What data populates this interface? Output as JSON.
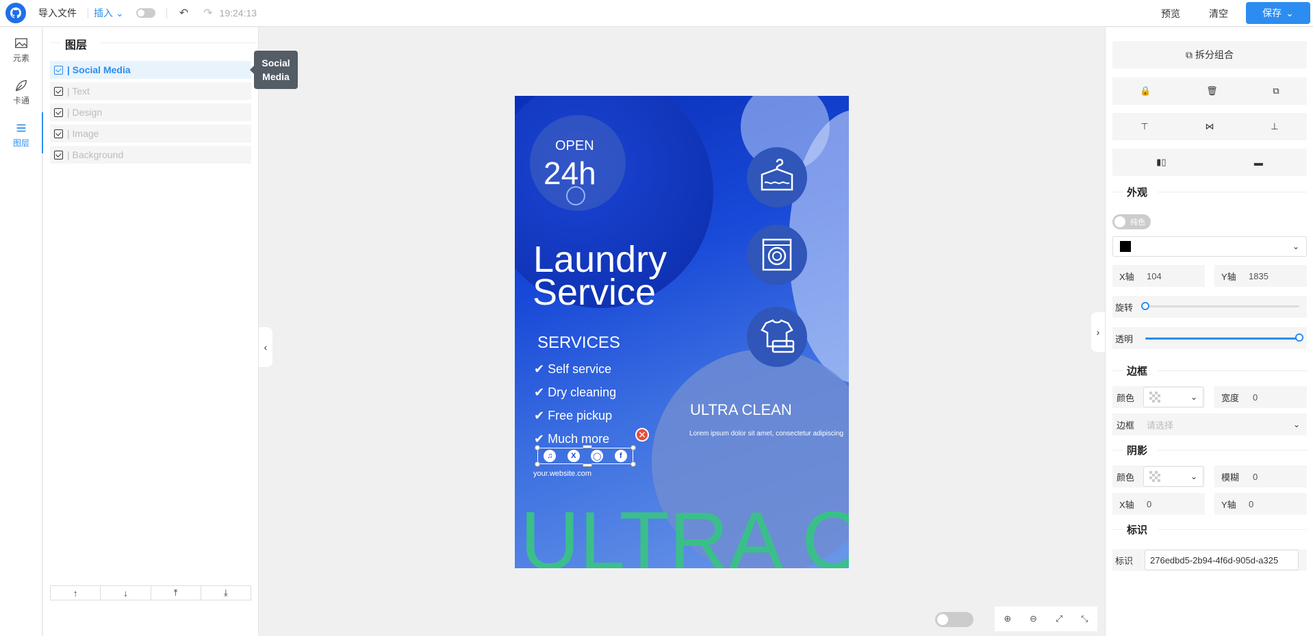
{
  "topbar": {
    "import_label": "导入文件",
    "insert_label": "插入",
    "time": "19:24:13",
    "preview_label": "预览",
    "clear_label": "清空",
    "save_label": "保存"
  },
  "leftnav": {
    "items": [
      {
        "label": "元素"
      },
      {
        "label": "卡通"
      },
      {
        "label": "图层"
      }
    ]
  },
  "layers": {
    "title": "图层",
    "items": [
      {
        "label": "| Social Media"
      },
      {
        "label": "| Text"
      },
      {
        "label": "| Design"
      },
      {
        "label": "| Image"
      },
      {
        "label": "| Background"
      }
    ],
    "tooltip": "Social Media"
  },
  "poster": {
    "open": "OPEN",
    "hours": "24h",
    "title1": "Laundry",
    "title2": "Service",
    "services_title": "SERVICES",
    "services": [
      "✔ Self service",
      "✔ Dry cleaning",
      "✔ Free pickup",
      "✔ Much more"
    ],
    "website": "your.website.com",
    "ultra_clean": "ULTRA CLEAN",
    "lorem": "Lorem ipsum dolor sit amet, consectetur adipiscing",
    "big_text": "ULTRA C"
  },
  "rightpanel": {
    "ungroup_label": "拆分组合",
    "appearance_title": "外观",
    "solid_label": "纯色",
    "fill_color": "#000000",
    "x_label": "X轴",
    "x_value": "104",
    "y_label": "Y轴",
    "y_value": "1835",
    "rotate_label": "旋转",
    "rotate_value": 0,
    "opacity_label": "透明",
    "opacity_value": 1,
    "border_title": "边框",
    "color_label": "颜色",
    "width_label": "宽度",
    "border_width": "0",
    "border_label": "边框",
    "border_placeholder": "请选择",
    "shadow_title": "阴影",
    "blur_label": "模糊",
    "blur_value": "0",
    "shadow_x_label": "X轴",
    "shadow_x_value": "0",
    "shadow_y_label": "Y轴",
    "shadow_y_value": "0",
    "id_title": "标识",
    "id_label": "标识",
    "id_value": "276edbd5-2b94-4f6d-905d-a325"
  }
}
